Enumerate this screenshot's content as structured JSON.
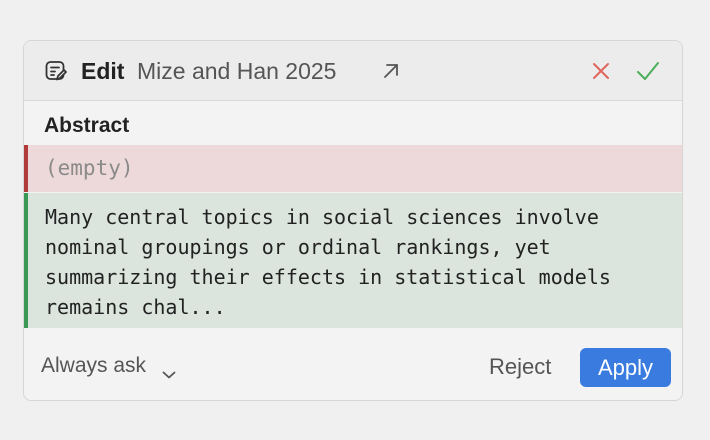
{
  "header": {
    "action_label": "Edit",
    "item_title": "Mize and Han 2025",
    "icons": {
      "item_type": "document-edit-icon",
      "open": "arrow-up-right-icon",
      "reject": "close-icon",
      "accept": "checkmark-icon"
    }
  },
  "field": {
    "label": "Abstract",
    "old_value": "(empty)",
    "new_value": "Many central topics in social sciences involve nominal groupings or ordinal rankings, yet summarizing their effects in statistical models remains chal..."
  },
  "footer": {
    "mode_label": "Always ask",
    "reject_label": "Reject",
    "apply_label": "Apply"
  },
  "colors": {
    "accent": "#3a7be0",
    "removed_bg": "#edd9d9",
    "removed_bar": "#b13a3a",
    "added_bg": "#dbe5de",
    "added_bar": "#3a9a55",
    "reject_icon": "#e0675f",
    "accept_icon": "#4cae5a"
  }
}
